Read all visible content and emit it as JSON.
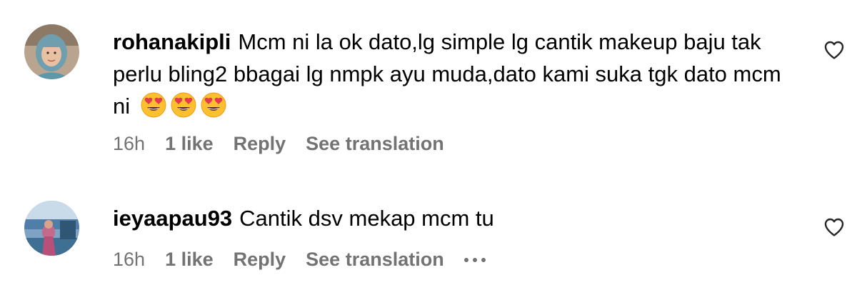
{
  "comments": [
    {
      "username": "rohanakipli",
      "text": "Mcm ni la ok dato,lg simple lg cantik makeup baju tak perlu bling2 bbagai lg nmpk ayu muda,dato kami suka tgk dato mcm ni",
      "emojis": [
        "smiling-face-with-heart-eyes",
        "smiling-face-with-heart-eyes",
        "smiling-face-with-heart-eyes"
      ],
      "time": "16h",
      "likes": "1 like",
      "reply": "Reply",
      "translate": "See translation",
      "like_icon": "heart-outline-icon"
    },
    {
      "username": "ieyaapau93",
      "text": "Cantik dsv mekap mcm tu",
      "time": "16h",
      "likes": "1 like",
      "reply": "Reply",
      "translate": "See translation",
      "more_icon": "more-options-icon",
      "like_icon": "heart-outline-icon"
    }
  ],
  "colors": {
    "text": "#000000",
    "meta": "#737373",
    "background": "#ffffff"
  }
}
